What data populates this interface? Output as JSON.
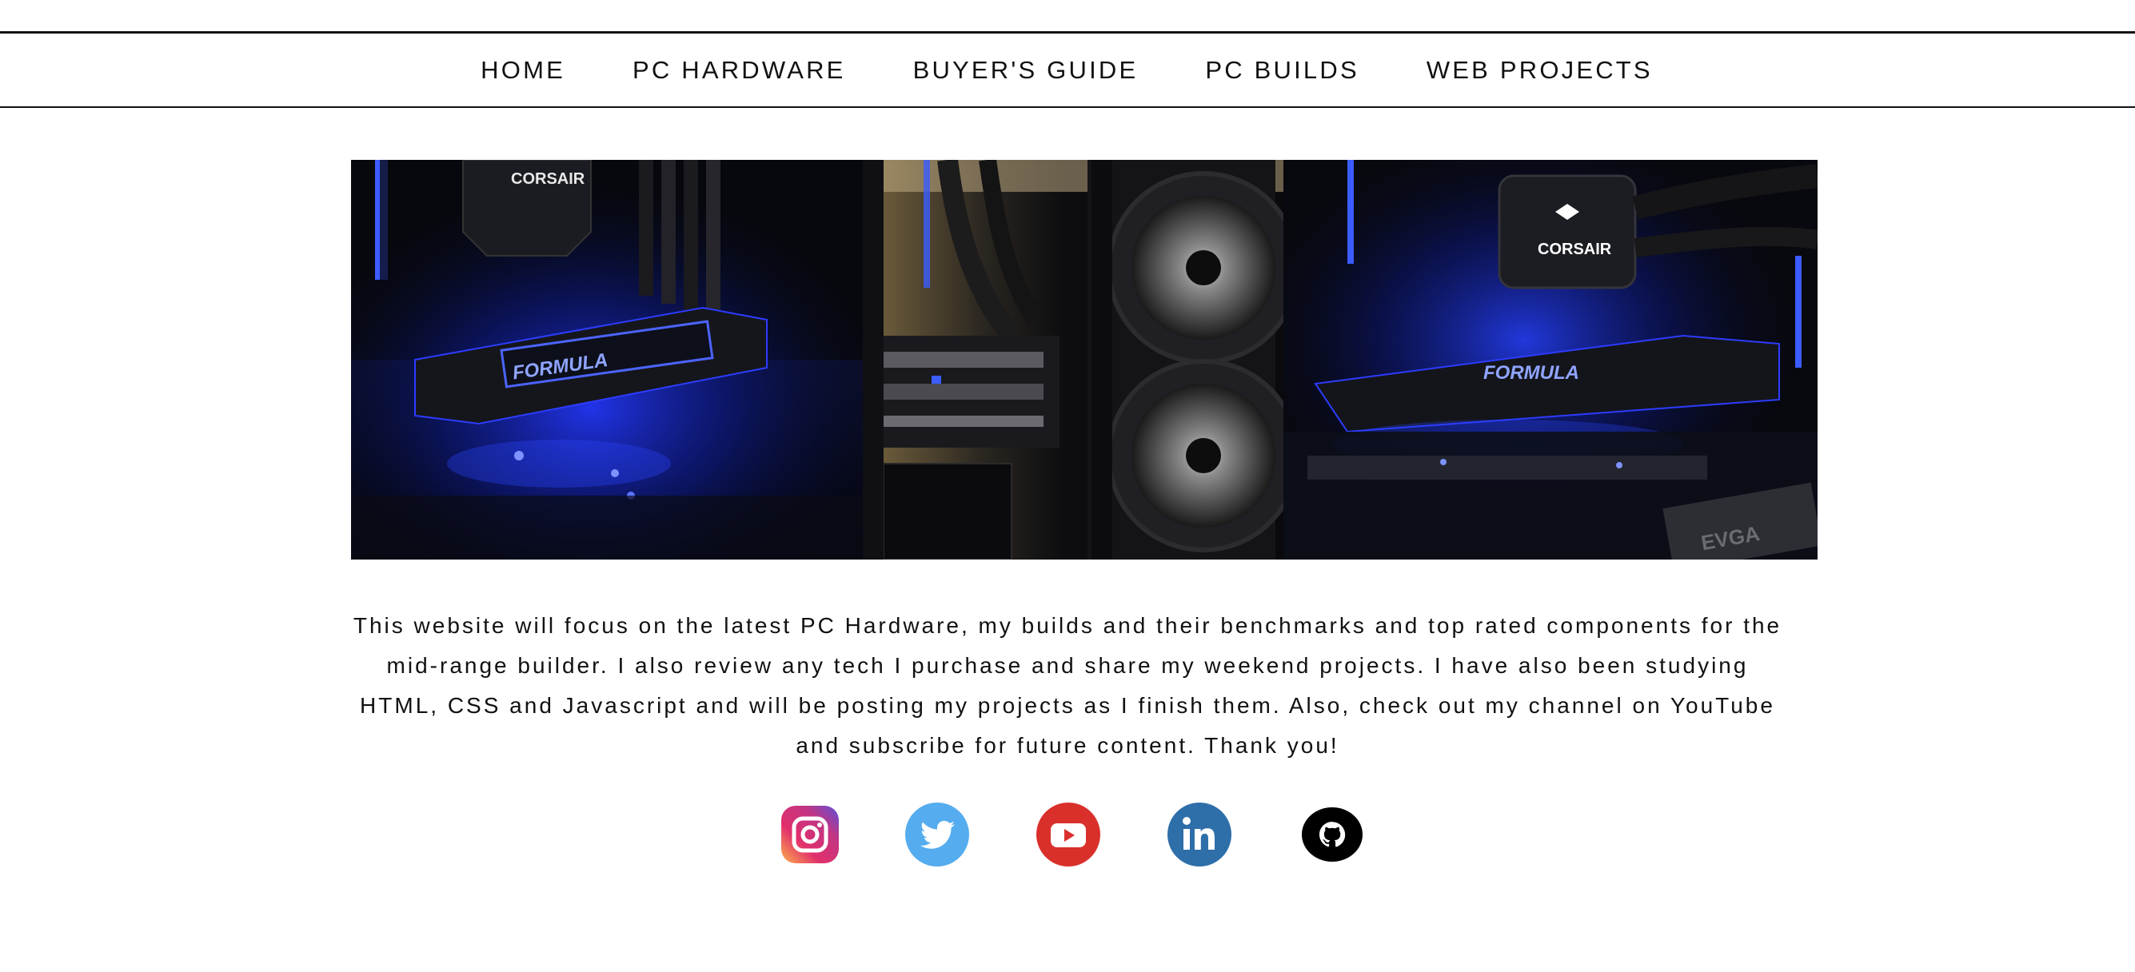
{
  "nav": {
    "items": [
      {
        "label": "HOME"
      },
      {
        "label": "PC HARDWARE"
      },
      {
        "label": "BUYER'S GUIDE"
      },
      {
        "label": "PC BUILDS"
      },
      {
        "label": "WEB PROJECTS"
      }
    ]
  },
  "hero": {
    "panels": [
      {
        "brand_logo": "CORSAIR",
        "board_label": "FORMULA"
      },
      {
        "brand_logo": "",
        "board_label": ""
      },
      {
        "brand_logo": "CORSAIR",
        "board_label": "FORMULA",
        "card_brand": "EVGA"
      }
    ]
  },
  "intro": {
    "text": "This website will focus on the latest PC Hardware, my builds and their benchmarks and top rated components for the mid-range builder. I also review any tech I purchase and share my weekend projects. I have also been studying HTML, CSS and Javascript and will be posting my projects as I finish them. Also, check out my channel on YouTube and subscribe for future content. Thank you!"
  },
  "social": [
    {
      "icon": "instagram-icon",
      "color": "#c13584"
    },
    {
      "icon": "twitter-icon",
      "color": "#55acee"
    },
    {
      "icon": "youtube-icon",
      "color": "#d9302c"
    },
    {
      "icon": "linkedin-icon",
      "color": "#2e6ea9"
    },
    {
      "icon": "github-icon",
      "color": "#000000"
    }
  ],
  "colors": {
    "accent_led_blue": "#1e46ff",
    "text": "#111111",
    "background": "#ffffff"
  }
}
